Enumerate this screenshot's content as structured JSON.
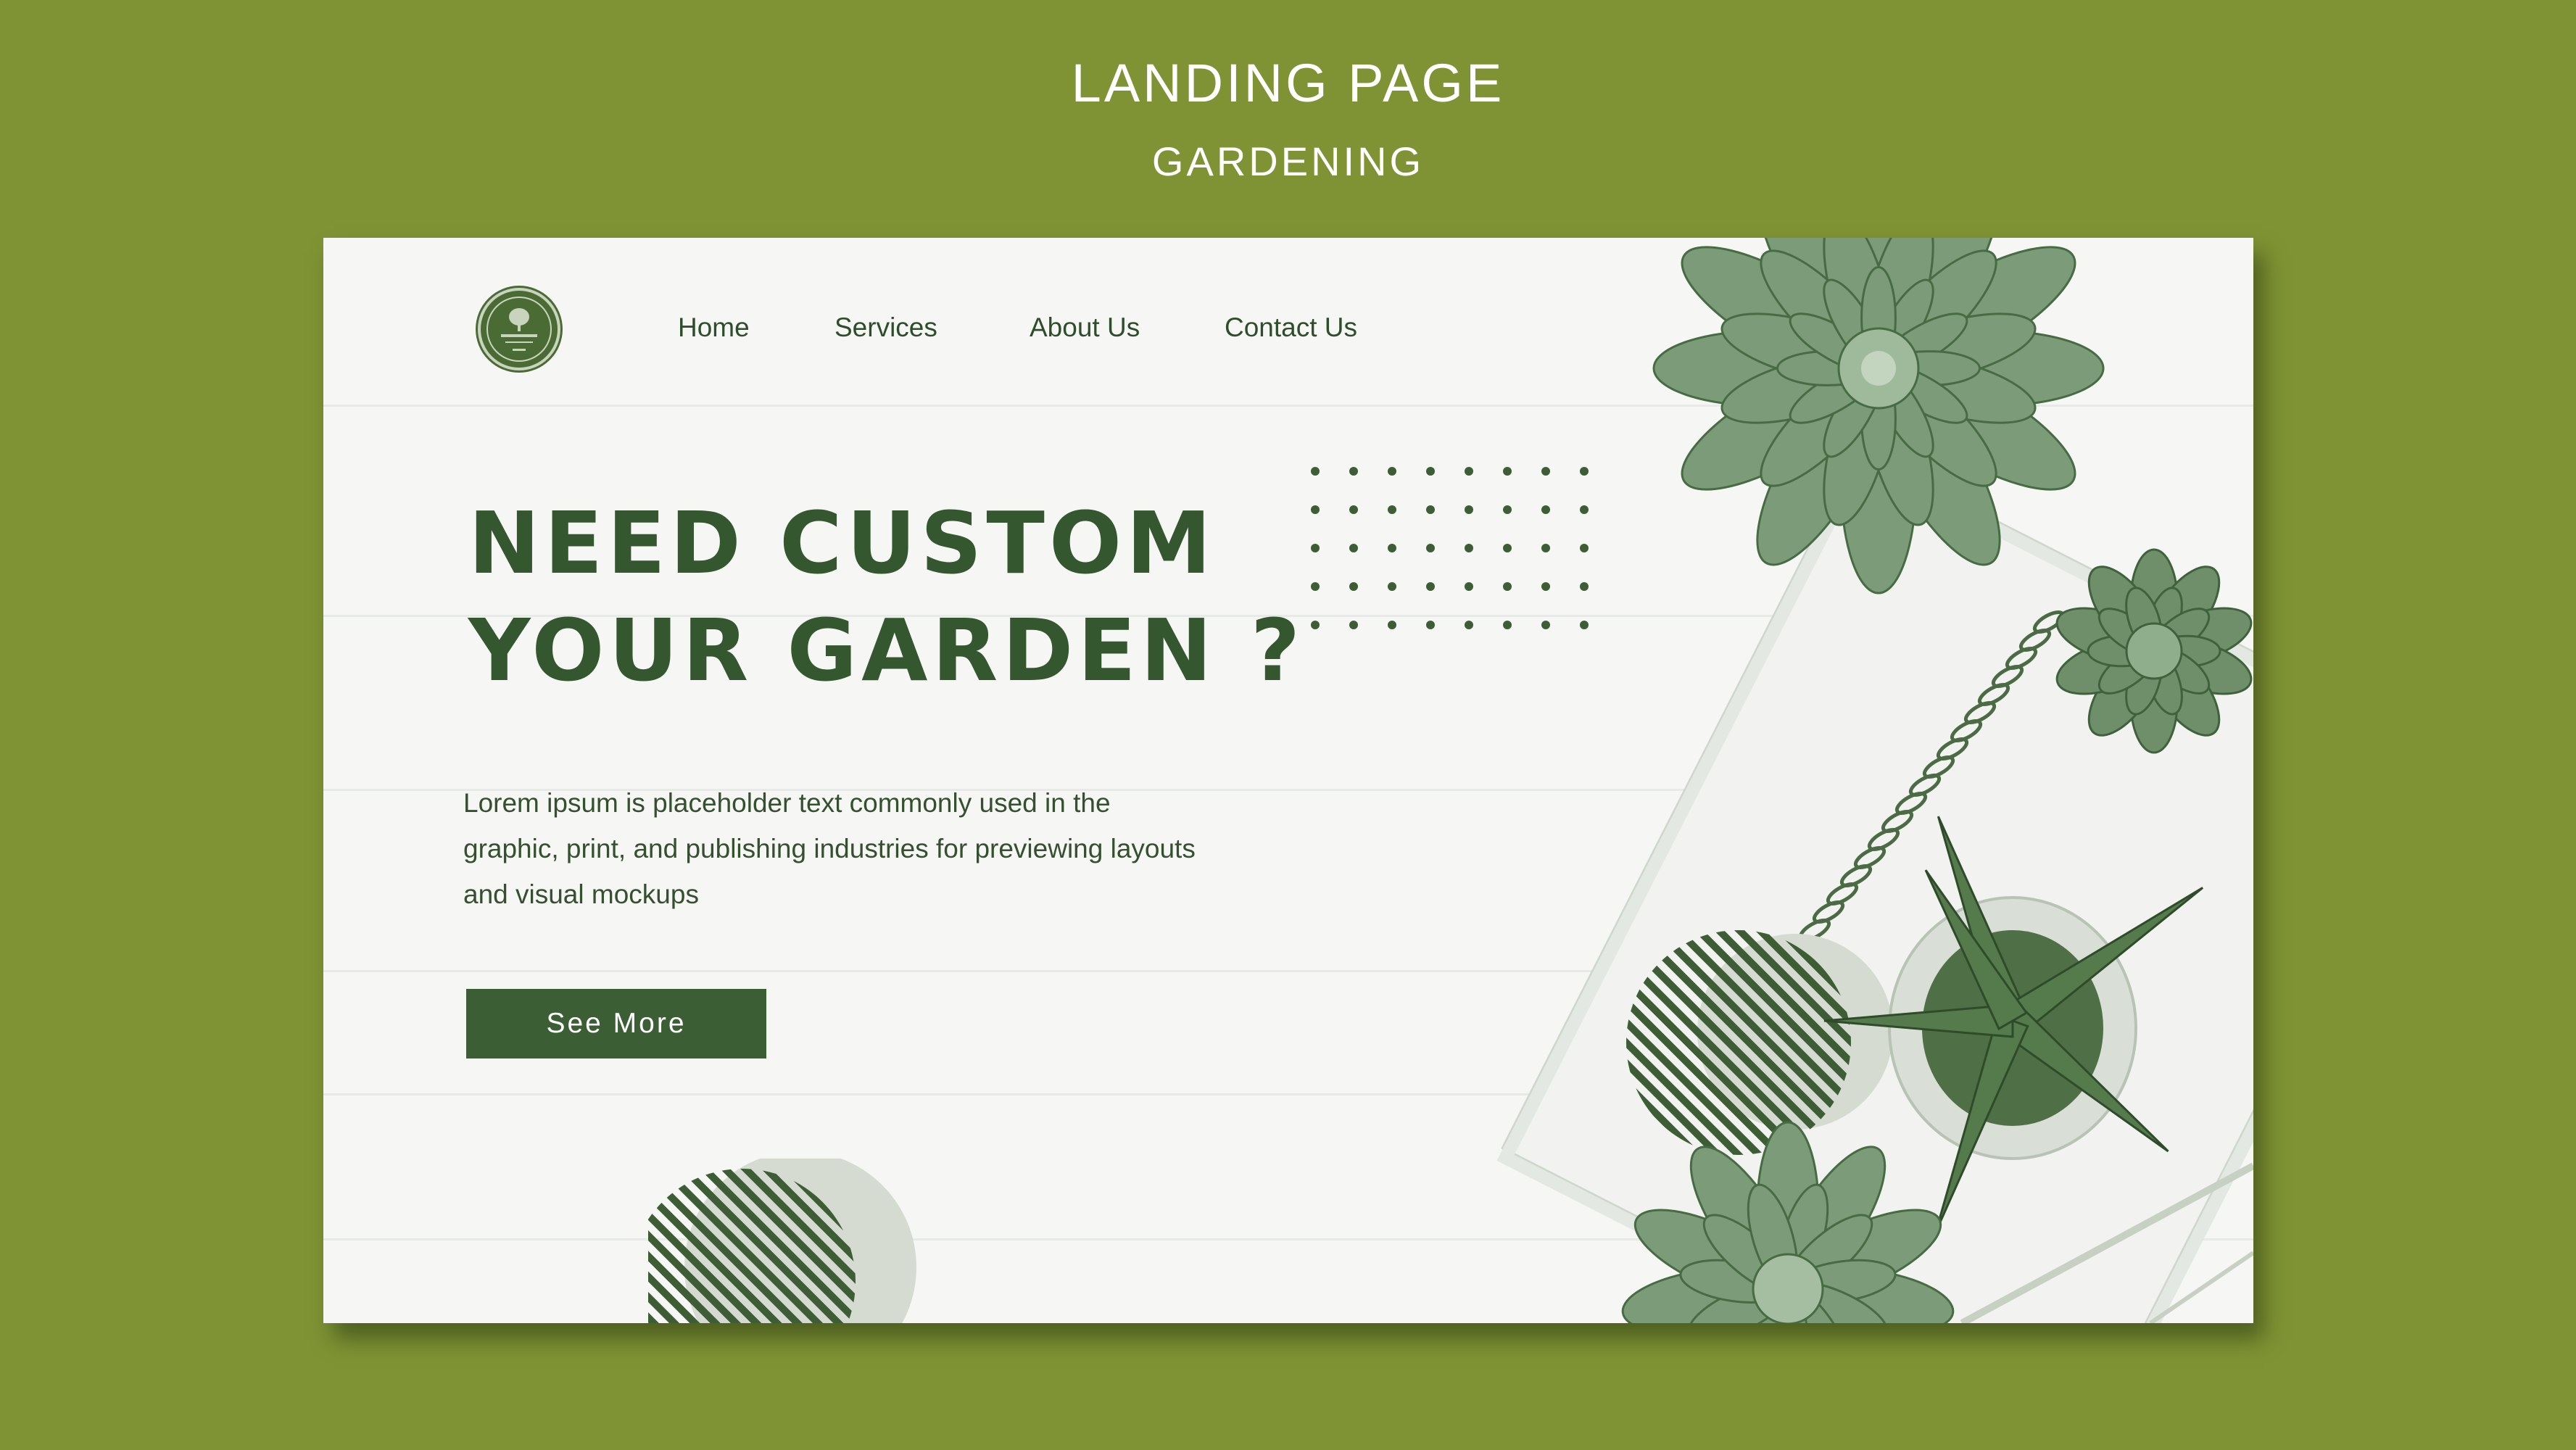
{
  "heading": {
    "title": "LANDING PAGE",
    "subtitle": "GARDENING"
  },
  "logo": {
    "name": "Garden Relax"
  },
  "nav": {
    "items": [
      {
        "label": "Home"
      },
      {
        "label": "Services"
      },
      {
        "label": "About Us"
      },
      {
        "label": "Contact Us"
      }
    ]
  },
  "hero": {
    "title_line1": "NEED CUSTOM",
    "title_line2": "YOUR GARDEN ?",
    "description": "Lorem ipsum is placeholder text commonly used in the graphic, print, and publishing industries for previewing layouts and visual mockups",
    "button_label": "See More"
  },
  "colors": {
    "page_background": "#7f9334",
    "card_background": "#f6f7f5",
    "primary_green": "#3b5e34",
    "heading_text": "#ffffff"
  }
}
